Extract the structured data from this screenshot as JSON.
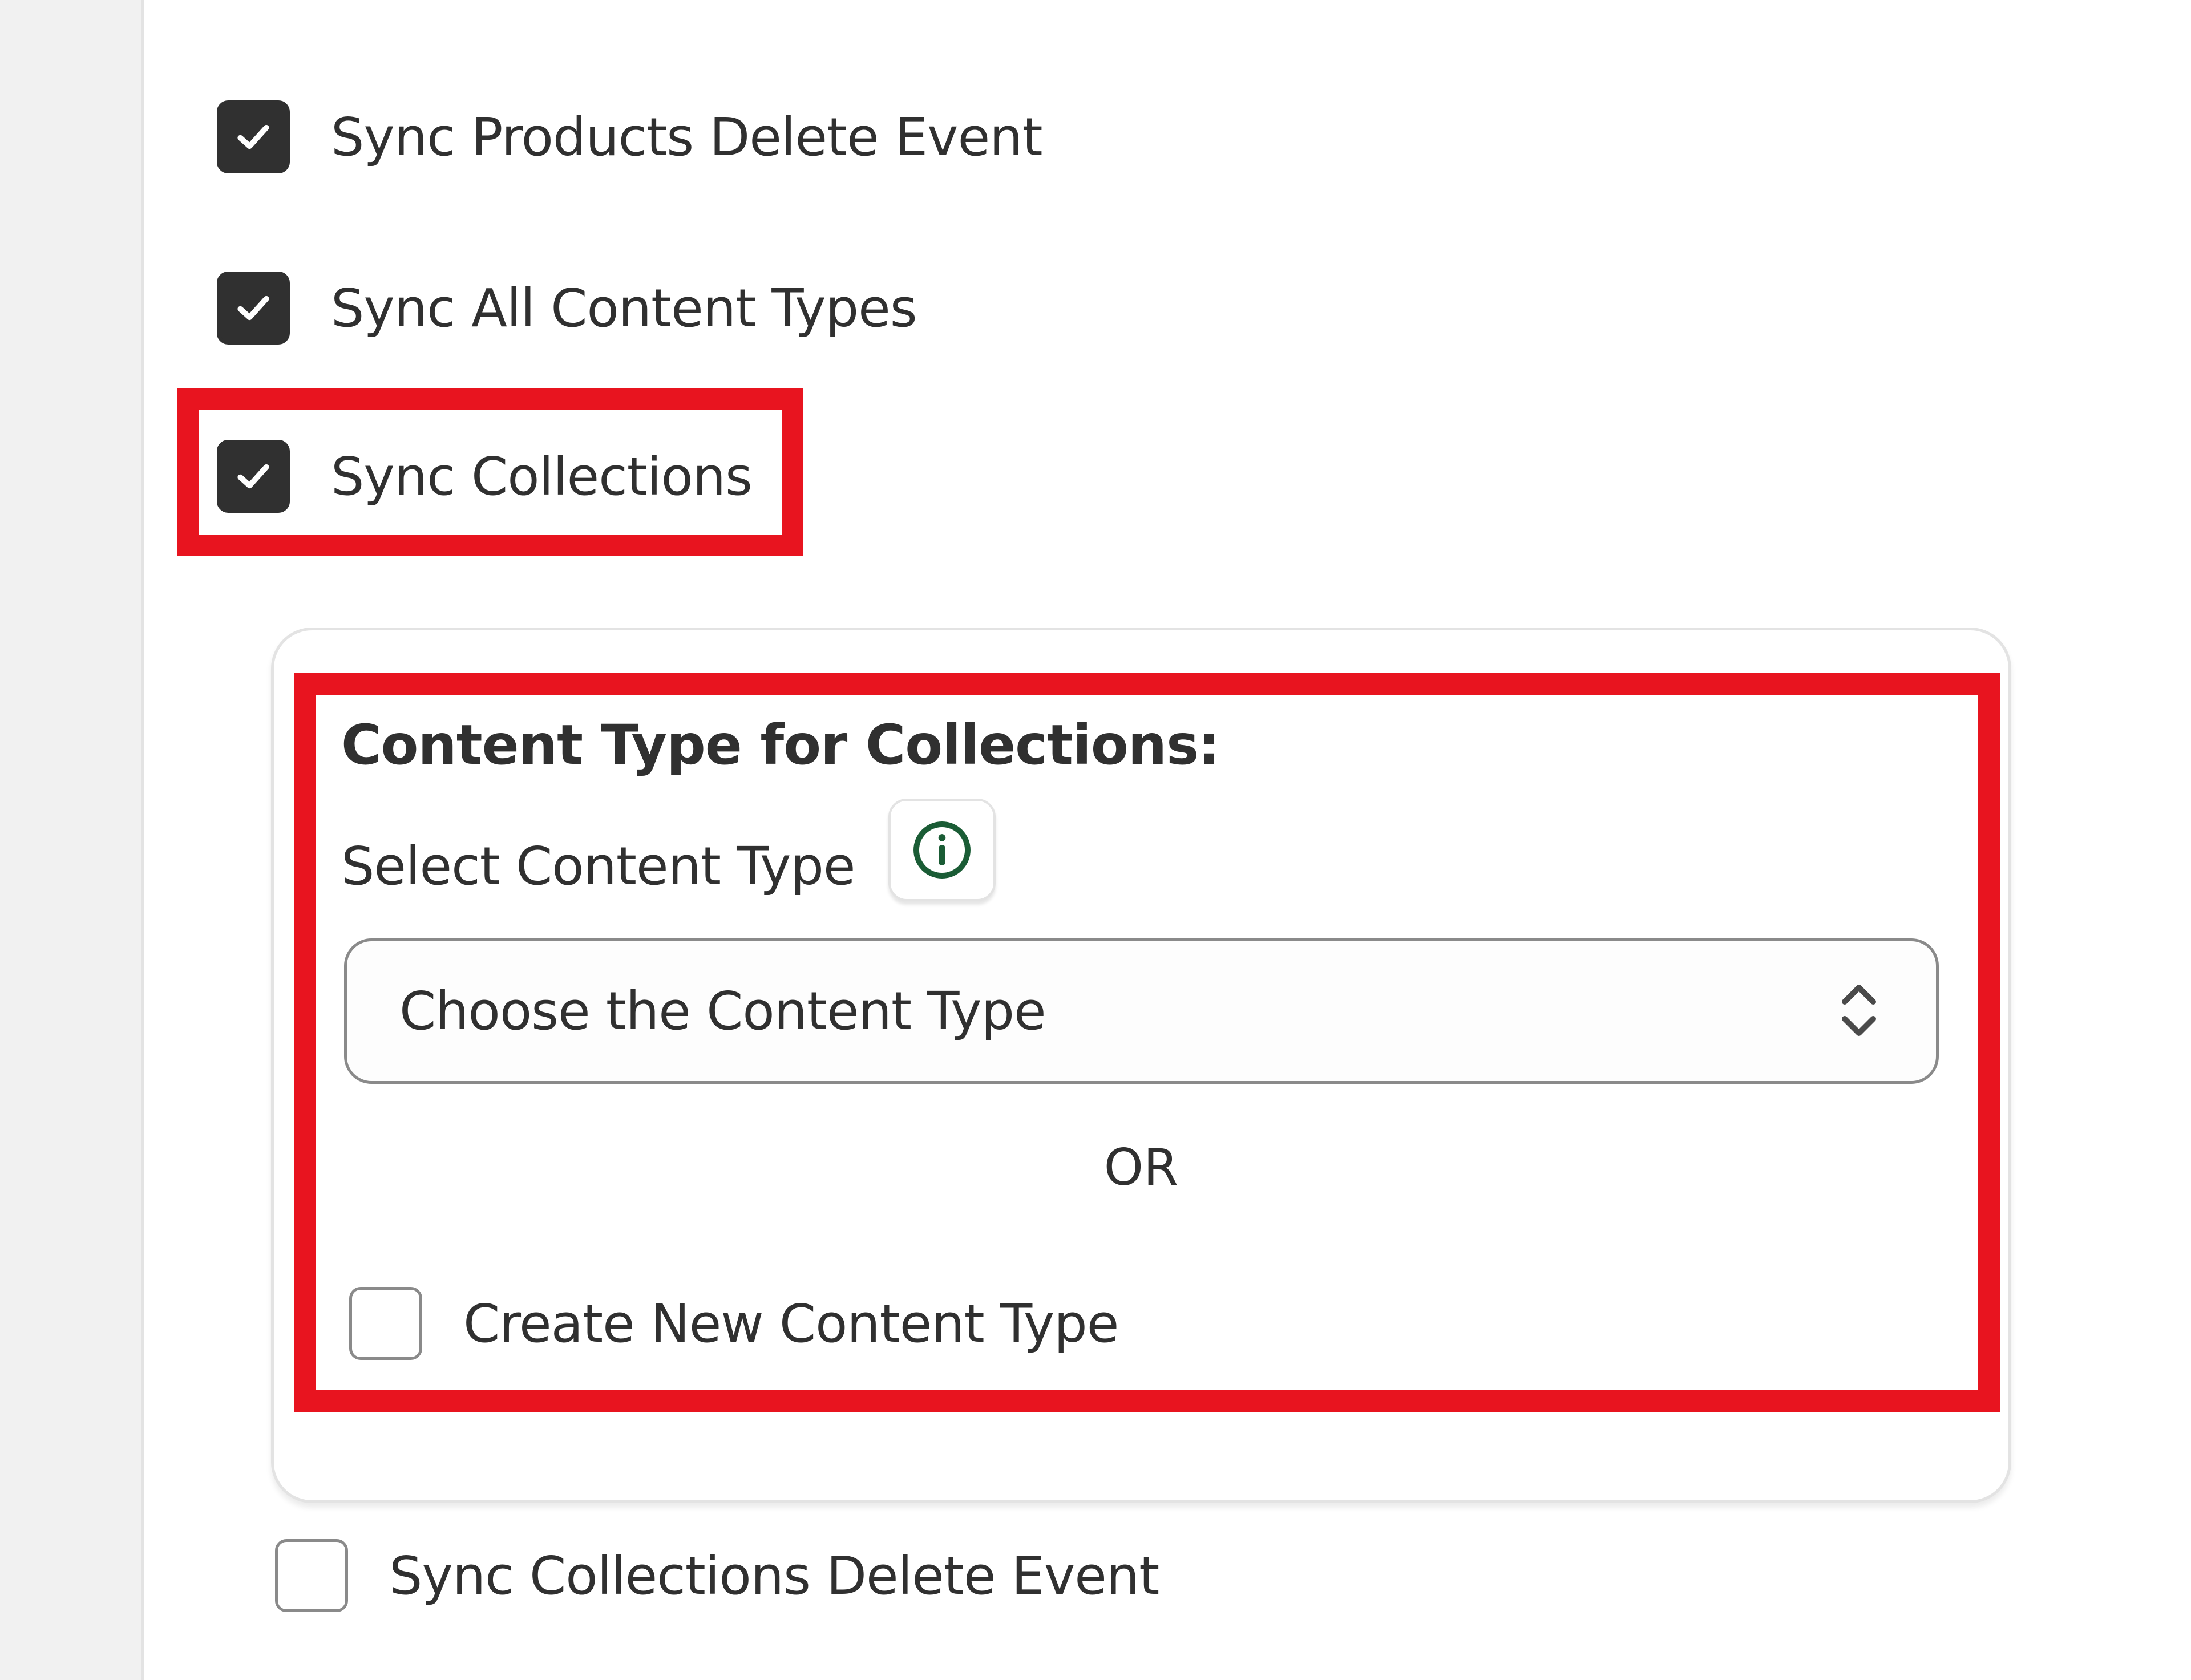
{
  "options": {
    "sync_products_delete": {
      "label": "Sync Products Delete Event",
      "checked": true
    },
    "sync_all_content_types": {
      "label": "Sync All Content Types",
      "checked": true
    },
    "sync_collections": {
      "label": "Sync Collections",
      "checked": true
    },
    "sync_collections_delete": {
      "label": "Sync Collections Delete Event",
      "checked": false
    }
  },
  "collections_panel": {
    "title": "Content Type for Collections:",
    "select_label": "Select Content Type",
    "select_placeholder": "Choose the Content Type",
    "or_text": "OR",
    "create_new": {
      "label": "Create New Content Type",
      "checked": false
    }
  },
  "colors": {
    "highlight": "#e8141f",
    "checkbox_checked": "#303030",
    "info_icon": "#1a5c35"
  }
}
